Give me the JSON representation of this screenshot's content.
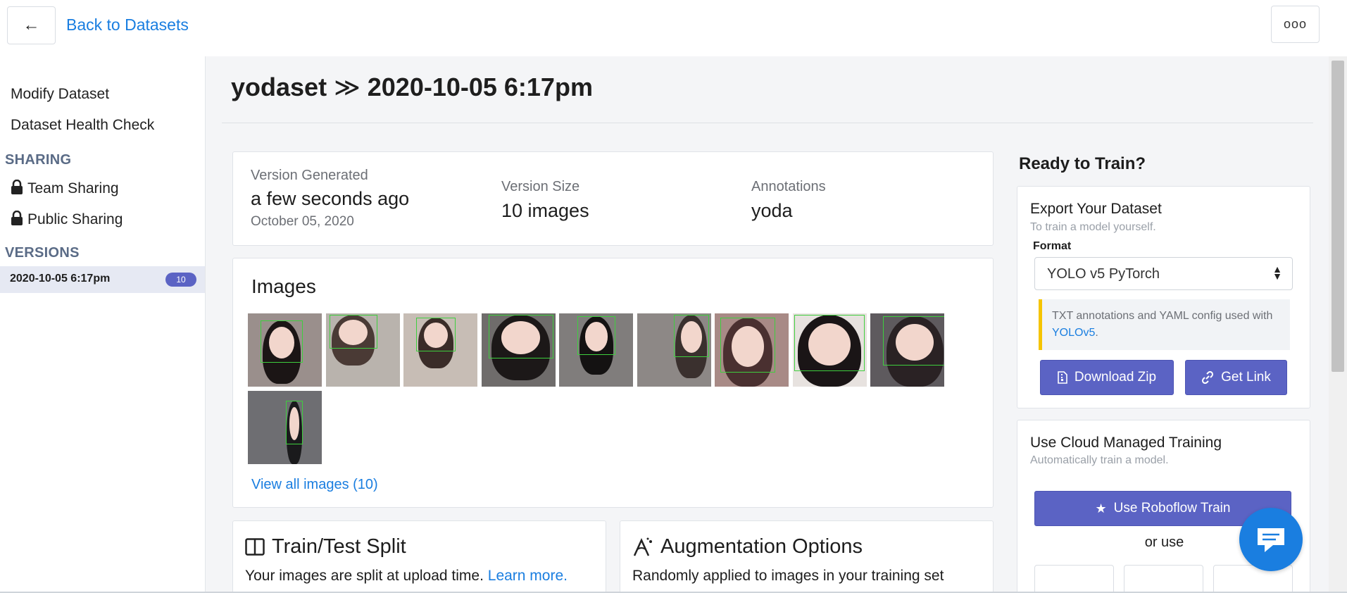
{
  "topbar": {
    "back_link": "Back to Datasets",
    "more_label": "ooo"
  },
  "sidebar": {
    "modify": "Modify Dataset",
    "health": "Dataset Health Check",
    "sharing_head": "SHARING",
    "team_sharing": "Team Sharing",
    "public_sharing": "Public Sharing",
    "versions_head": "VERSIONS",
    "version_label": "2020-10-05 6:17pm",
    "version_count": "10"
  },
  "header": {
    "dataset": "yodaset",
    "separator": "≫",
    "version": "2020-10-05 6:17pm"
  },
  "summary": {
    "generated_label": "Version Generated",
    "generated_value": "a few seconds ago",
    "generated_date": "October 05, 2020",
    "size_label": "Version Size",
    "size_value": "10 images",
    "annotations_label": "Annotations",
    "annotations_value": "yoda"
  },
  "images": {
    "title": "Images",
    "view_all": "View all images (10)",
    "count": 10
  },
  "split": {
    "title": "Train/Test Split",
    "text": "Your images are split at upload time.",
    "link": "Learn more."
  },
  "augment": {
    "title": "Augmentation Options",
    "text": "Randomly applied to images in your training set"
  },
  "right": {
    "ready": "Ready to Train?",
    "export_title": "Export Your Dataset",
    "export_sub": "To train a model yourself.",
    "format_label": "Format",
    "format_value": "YOLO v5 PyTorch",
    "note_text": "TXT annotations and YAML config used with",
    "note_link": "YOLOv5",
    "note_end": ".",
    "download": "Download Zip",
    "get_link": "Get Link",
    "cloud_title": "Use Cloud Managed Training",
    "cloud_sub": "Automatically train a model.",
    "roboflow_train": "Use Roboflow Train",
    "or_use": "or use"
  }
}
